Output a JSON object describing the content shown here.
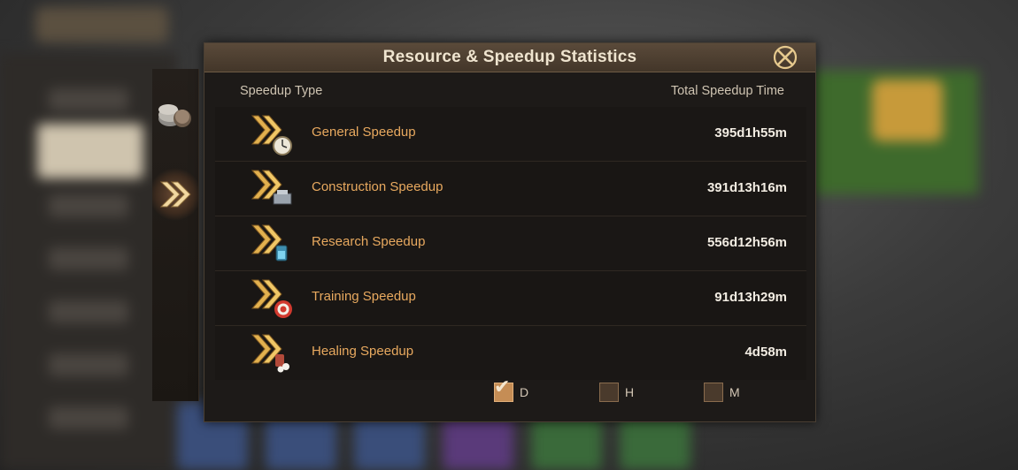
{
  "panel": {
    "title": "Resource & Speedup Statistics",
    "col_type": "Speedup Type",
    "col_time": "Total Speedup Time"
  },
  "rows": [
    {
      "label": "General Speedup",
      "value": "395d1h55m",
      "icon": "general-speedup-icon"
    },
    {
      "label": "Construction Speedup",
      "value": "391d13h16m",
      "icon": "construction-speedup-icon"
    },
    {
      "label": "Research Speedup",
      "value": "556d12h56m",
      "icon": "research-speedup-icon"
    },
    {
      "label": "Training Speedup",
      "value": "91d13h29m",
      "icon": "training-speedup-icon"
    },
    {
      "label": "Healing Speedup",
      "value": "4d58m",
      "icon": "healing-speedup-icon"
    }
  ],
  "units": [
    {
      "label": "D",
      "checked": true
    },
    {
      "label": "H",
      "checked": false
    },
    {
      "label": "M",
      "checked": false
    }
  ],
  "side_tabs": [
    {
      "icon": "resources-tab-icon",
      "active": false
    },
    {
      "icon": "speedup-tab-icon",
      "active": true
    }
  ],
  "colors": {
    "accent_gold": "#e0a94a",
    "label_orange": "#e8a95f"
  }
}
